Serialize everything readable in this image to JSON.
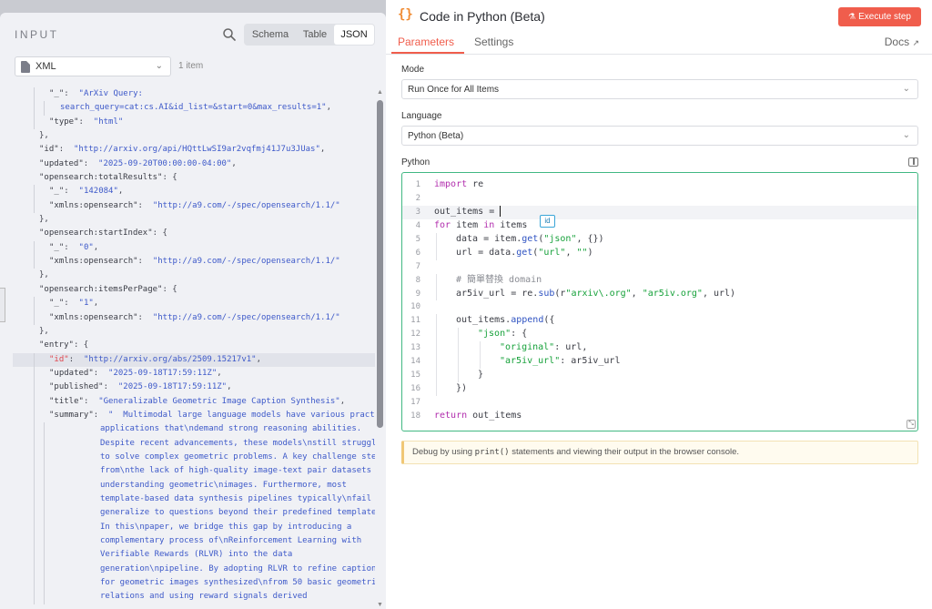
{
  "input_panel": {
    "title": "INPUT",
    "view_tabs": [
      "Schema",
      "Table",
      "JSON"
    ],
    "active_view": "JSON",
    "format": "XML",
    "item_count": "1 item",
    "json_lines": [
      {
        "i": 1,
        "parts": [
          [
            "k",
            "\"_\""
          ],
          [
            "p",
            ":  "
          ],
          [
            "s",
            "\"ArXiv Query:"
          ]
        ]
      },
      {
        "i": 2,
        "parts": [
          [
            "s",
            "search_query=cat:cs.AI&id_list=&start=0&max_results=1\""
          ],
          [
            "p",
            ","
          ]
        ]
      },
      {
        "i": 1,
        "parts": [
          [
            "k",
            "\"type\""
          ],
          [
            "p",
            ":  "
          ],
          [
            "s",
            "\"html\""
          ]
        ]
      },
      {
        "i": 0,
        "parts": [
          [
            "p",
            "},"
          ]
        ]
      },
      {
        "i": 0,
        "parts": [
          [
            "k",
            "\"id\""
          ],
          [
            "p",
            ":  "
          ],
          [
            "s",
            "\"http://arxiv.org/api/HQttLwSI9ar2vqfmj41J7u3JUas\""
          ],
          [
            "p",
            ","
          ]
        ]
      },
      {
        "i": 0,
        "parts": [
          [
            "k",
            "\"updated\""
          ],
          [
            "p",
            ":  "
          ],
          [
            "s",
            "\"2025-09-20T00:00:00-04:00\""
          ],
          [
            "p",
            ","
          ]
        ]
      },
      {
        "i": 0,
        "parts": [
          [
            "k",
            "\"opensearch:totalResults\""
          ],
          [
            "p",
            ": {"
          ]
        ]
      },
      {
        "i": 1,
        "parts": [
          [
            "k",
            "\"_\""
          ],
          [
            "p",
            ":  "
          ],
          [
            "s",
            "\"142084\""
          ],
          [
            "p",
            ","
          ]
        ]
      },
      {
        "i": 1,
        "parts": [
          [
            "k",
            "\"xmlns:opensearch\""
          ],
          [
            "p",
            ":  "
          ],
          [
            "s",
            "\"http://a9.com/-/spec/opensearch/1.1/\""
          ]
        ]
      },
      {
        "i": 0,
        "parts": [
          [
            "p",
            "},"
          ]
        ]
      },
      {
        "i": 0,
        "parts": [
          [
            "k",
            "\"opensearch:startIndex\""
          ],
          [
            "p",
            ": {"
          ]
        ]
      },
      {
        "i": 1,
        "parts": [
          [
            "k",
            "\"_\""
          ],
          [
            "p",
            ":  "
          ],
          [
            "s",
            "\"0\""
          ],
          [
            "p",
            ","
          ]
        ]
      },
      {
        "i": 1,
        "parts": [
          [
            "k",
            "\"xmlns:opensearch\""
          ],
          [
            "p",
            ":  "
          ],
          [
            "s",
            "\"http://a9.com/-/spec/opensearch/1.1/\""
          ]
        ]
      },
      {
        "i": 0,
        "parts": [
          [
            "p",
            "},"
          ]
        ]
      },
      {
        "i": 0,
        "parts": [
          [
            "k",
            "\"opensearch:itemsPerPage\""
          ],
          [
            "p",
            ": {"
          ]
        ]
      },
      {
        "i": 1,
        "parts": [
          [
            "k",
            "\"_\""
          ],
          [
            "p",
            ":  "
          ],
          [
            "s",
            "\"1\""
          ],
          [
            "p",
            ","
          ]
        ]
      },
      {
        "i": 1,
        "parts": [
          [
            "k",
            "\"xmlns:opensearch\""
          ],
          [
            "p",
            ":  "
          ],
          [
            "s",
            "\"http://a9.com/-/spec/opensearch/1.1/\""
          ]
        ]
      },
      {
        "i": 0,
        "parts": [
          [
            "p",
            "},"
          ]
        ]
      },
      {
        "i": 0,
        "parts": [
          [
            "k",
            "\"entry\""
          ],
          [
            "p",
            ": {"
          ]
        ]
      },
      {
        "i": 1,
        "hl": true,
        "parts": [
          [
            "kr",
            "\"id\""
          ],
          [
            "p",
            ":  "
          ],
          [
            "s",
            "\"http://arxiv.org/abs/2509.15217v1\""
          ],
          [
            "p",
            ","
          ]
        ]
      },
      {
        "i": 1,
        "parts": [
          [
            "k",
            "\"updated\""
          ],
          [
            "p",
            ":  "
          ],
          [
            "s",
            "\"2025-09-18T17:59:11Z\""
          ],
          [
            "p",
            ","
          ]
        ]
      },
      {
        "i": 1,
        "parts": [
          [
            "k",
            "\"published\""
          ],
          [
            "p",
            ":  "
          ],
          [
            "s",
            "\"2025-09-18T17:59:11Z\""
          ],
          [
            "p",
            ","
          ]
        ]
      },
      {
        "i": 1,
        "parts": [
          [
            "k",
            "\"title\""
          ],
          [
            "p",
            ":  "
          ],
          [
            "s",
            "\"Generalizable Geometric Image Caption Synthesis\""
          ],
          [
            "p",
            ","
          ]
        ]
      },
      {
        "i": 1,
        "parts": [
          [
            "k",
            "\"summary\""
          ],
          [
            "p",
            ":  "
          ],
          [
            "s",
            "\"  Multimodal large language models have various practical"
          ]
        ]
      },
      {
        "i": 3,
        "parts": [
          [
            "s",
            "applications that\\ndemand strong reasoning abilities."
          ]
        ]
      },
      {
        "i": 3,
        "parts": [
          [
            "s",
            "Despite recent advancements, these models\\nstill struggle"
          ]
        ]
      },
      {
        "i": 3,
        "parts": [
          [
            "s",
            "to solve complex geometric problems. A key challenge stems"
          ]
        ]
      },
      {
        "i": 3,
        "parts": [
          [
            "s",
            "from\\nthe lack of high-quality image-text pair datasets for"
          ]
        ]
      },
      {
        "i": 3,
        "parts": [
          [
            "s",
            "understanding geometric\\nimages. Furthermore, most"
          ]
        ]
      },
      {
        "i": 3,
        "parts": [
          [
            "s",
            "template-based data synthesis pipelines typically\\nfail to"
          ]
        ]
      },
      {
        "i": 3,
        "parts": [
          [
            "s",
            "generalize to questions beyond their predefined templates."
          ]
        ]
      },
      {
        "i": 3,
        "parts": [
          [
            "s",
            "In this\\npaper, we bridge this gap by introducing a"
          ]
        ]
      },
      {
        "i": 3,
        "parts": [
          [
            "s",
            "complementary process of\\nReinforcement Learning with"
          ]
        ]
      },
      {
        "i": 3,
        "parts": [
          [
            "s",
            "Verifiable Rewards (RLVR) into the data"
          ]
        ]
      },
      {
        "i": 3,
        "parts": [
          [
            "s",
            "generation\\npipeline. By adopting RLVR to refine captions"
          ]
        ]
      },
      {
        "i": 3,
        "parts": [
          [
            "s",
            "for geometric images synthesized\\nfrom 50 basic geometric"
          ]
        ]
      },
      {
        "i": 3,
        "parts": [
          [
            "s",
            "relations and using reward signals derived"
          ]
        ]
      }
    ]
  },
  "node": {
    "title": "Code in Python (Beta)",
    "execute_label": "Execute step",
    "tabs": [
      "Parameters",
      "Settings"
    ],
    "active_tab": "Parameters",
    "docs_label": "Docs",
    "mode_label": "Mode",
    "mode_value": "Run Once for All Items",
    "language_label": "Language",
    "language_value": "Python (Beta)",
    "code_label": "Python",
    "autocomplete_hint": "id",
    "notice_before": "Debug by using ",
    "notice_code": "print()",
    "notice_after": " statements and viewing their output in the browser console."
  },
  "code_lines": [
    {
      "n": "1",
      "i": 0,
      "parts": [
        [
          "kw",
          "import"
        ],
        [
          "p",
          " re"
        ]
      ]
    },
    {
      "n": "2",
      "i": 0,
      "parts": []
    },
    {
      "n": "3",
      "i": 0,
      "cur": true,
      "parts": [
        [
          "p",
          "out_items = "
        ]
      ]
    },
    {
      "n": "4",
      "i": 0,
      "parts": [
        [
          "kw",
          "for"
        ],
        [
          "p",
          " item "
        ],
        [
          "kw",
          "in"
        ],
        [
          "p",
          " items"
        ]
      ]
    },
    {
      "n": "5",
      "i": 1,
      "parts": [
        [
          "p",
          "data = item."
        ],
        [
          "fn",
          "get"
        ],
        [
          "p",
          "("
        ],
        [
          "str",
          "\"json\""
        ],
        [
          "p",
          ", {})"
        ]
      ]
    },
    {
      "n": "6",
      "i": 1,
      "parts": [
        [
          "p",
          "url = data."
        ],
        [
          "fn",
          "get"
        ],
        [
          "p",
          "("
        ],
        [
          "str",
          "\"url\""
        ],
        [
          "p",
          ", "
        ],
        [
          "str",
          "\"\""
        ],
        [
          "p",
          ")"
        ]
      ]
    },
    {
      "n": "7",
      "i": 0,
      "parts": []
    },
    {
      "n": "8",
      "i": 1,
      "parts": [
        [
          "cm",
          "# 簡單替換 domain"
        ]
      ]
    },
    {
      "n": "9",
      "i": 1,
      "parts": [
        [
          "p",
          "ar5iv_url = re."
        ],
        [
          "fn",
          "sub"
        ],
        [
          "p",
          "(r"
        ],
        [
          "str",
          "\"arxiv\\.org\""
        ],
        [
          "p",
          ", "
        ],
        [
          "str",
          "\"ar5iv.org\""
        ],
        [
          "p",
          ", url)"
        ]
      ]
    },
    {
      "n": "10",
      "i": 0,
      "parts": []
    },
    {
      "n": "11",
      "i": 1,
      "parts": [
        [
          "p",
          "out_items."
        ],
        [
          "fn",
          "append"
        ],
        [
          "p",
          "({"
        ]
      ]
    },
    {
      "n": "12",
      "i": 2,
      "parts": [
        [
          "str",
          "\"json\""
        ],
        [
          "p",
          ": {"
        ]
      ]
    },
    {
      "n": "13",
      "i": 3,
      "parts": [
        [
          "str",
          "\"original\""
        ],
        [
          "p",
          ": url,"
        ]
      ]
    },
    {
      "n": "14",
      "i": 3,
      "parts": [
        [
          "str",
          "\"ar5iv_url\""
        ],
        [
          "p",
          ": ar5iv_url"
        ]
      ]
    },
    {
      "n": "15",
      "i": 2,
      "parts": [
        [
          "p",
          "}"
        ]
      ]
    },
    {
      "n": "16",
      "i": 1,
      "parts": [
        [
          "p",
          "})"
        ]
      ]
    },
    {
      "n": "17",
      "i": 0,
      "parts": []
    },
    {
      "n": "18",
      "i": 0,
      "parts": [
        [
          "kw",
          "return"
        ],
        [
          "p",
          " out_items"
        ]
      ]
    }
  ]
}
